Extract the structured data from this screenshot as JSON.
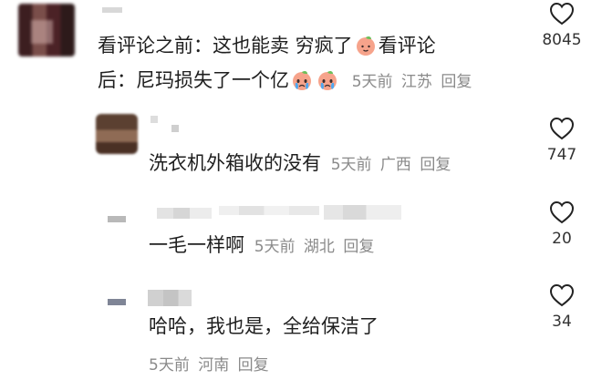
{
  "comments": [
    {
      "line1": "看评论之前：这也能卖 穷疯了",
      "line1b": "看评论",
      "line2": "后：尼玛损失了一个亿",
      "time": "5天前",
      "location": "江苏",
      "reply": "回复",
      "likes": "8045"
    },
    {
      "text": "洗衣机外箱收的没有",
      "time": "5天前",
      "location": "广西",
      "reply": "回复",
      "likes": "747"
    },
    {
      "text": "一毛一样啊",
      "time": "5天前",
      "location": "湖北",
      "reply": "回复",
      "likes": "20"
    },
    {
      "text": "哈哈，我也是，全给保洁了",
      "time": "5天前",
      "location": "河南",
      "reply": "回复",
      "likes": "34"
    }
  ],
  "icons": {
    "like": "heart-outline-icon",
    "peach": "peach-emoji-icon",
    "crying": "crying-face-emoji-icon"
  }
}
